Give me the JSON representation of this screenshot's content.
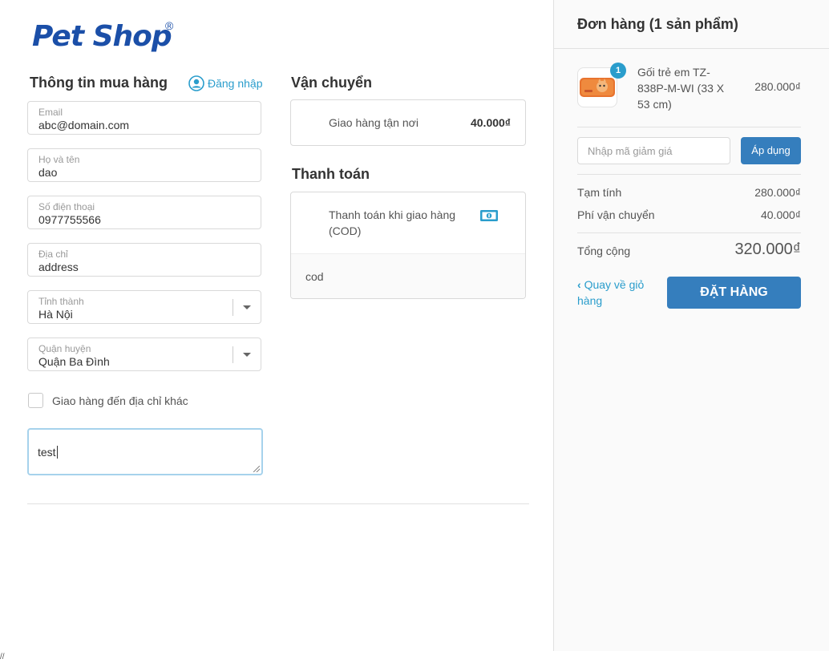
{
  "brand": {
    "name": "Pet Shop",
    "trademark": "®"
  },
  "checkout_info": {
    "heading": "Thông tin mua hàng",
    "login_label": "Đăng nhập",
    "fields": [
      {
        "label": "Email",
        "value": "abc@domain.com"
      },
      {
        "label": "Họ và tên",
        "value": "dao"
      },
      {
        "label": "Số điện thoại",
        "value": "0977755566"
      },
      {
        "label": "Địa chỉ",
        "value": "address"
      },
      {
        "label": "Tỉnh thành",
        "value": "Hà Nội"
      },
      {
        "label": "Quận huyện",
        "value": "Quận Ba Đình"
      }
    ],
    "alt_address_label": "Giao hàng đến địa chỉ khác",
    "note_value": "test"
  },
  "shipping": {
    "heading": "Vận chuyển",
    "option_label": "Giao hàng tận nơi",
    "option_price": "40.000₫"
  },
  "payment": {
    "heading": "Thanh toán",
    "option_label": "Thanh toán khi giao hàng (COD)",
    "detail": "cod"
  },
  "order": {
    "title": "Đơn hàng (1 sản phẩm)",
    "item": {
      "quantity": "1",
      "name": "Gối trẻ em TZ-838P-M-WI (33 X 53 cm)",
      "price": "280.000₫"
    },
    "coupon_placeholder": "Nhập mã giảm giá",
    "apply_label": "Áp dụng",
    "subtotal_label": "Tạm tính",
    "subtotal_value": "280.000₫",
    "shipping_label": "Phí vận chuyển",
    "shipping_value": "40.000₫",
    "total_label": "Tổng cộng",
    "total_value": "320.000₫",
    "back_label": "Quay về giỏ hàng",
    "order_button": "ĐẶT HÀNG"
  },
  "footer": {
    "mark": "//"
  },
  "colors": {
    "primary": "#357ebd",
    "link": "#2a9dcc",
    "brand": "#1b4fa8"
  },
  "icons": [
    "user-circle-icon",
    "chevron-left-icon",
    "cash-icon",
    "chevron-down-icon"
  ]
}
